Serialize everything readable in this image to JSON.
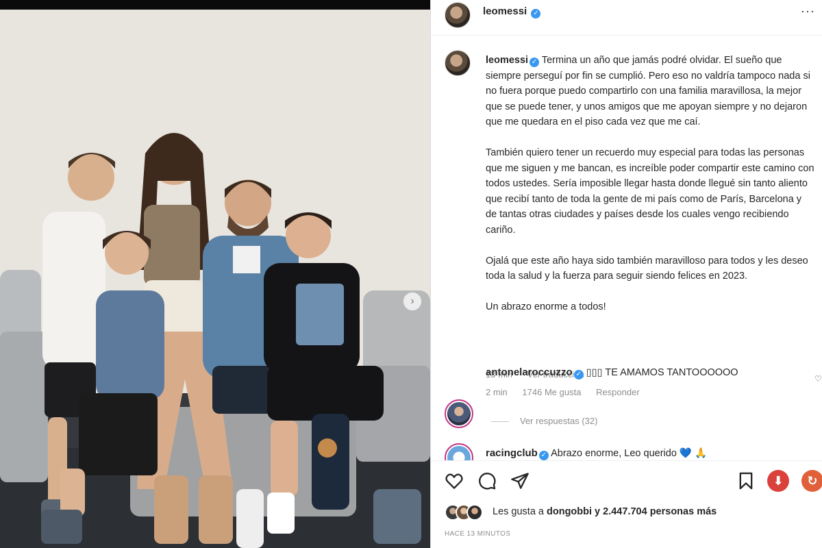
{
  "header": {
    "username": "leomessi",
    "verified_mark": "✓",
    "more_icon": "···"
  },
  "photo": {
    "carousel_next": "›"
  },
  "caption": {
    "username": "leomessi",
    "paragraphs": [
      "Termina un año que jamás podré olvidar. El sueño que siempre perseguí por fin se cumplió. Pero eso no valdría tampoco nada si no fuera porque puedo compartirlo con una familia maravillosa, la mejor que se puede tener, y unos amigos que me apoyan siempre y no dejaron que me quedara en el piso cada vez que me caí.",
      "También quiero tener un recuerdo muy especial para todas las personas que me siguen y me bancan, es increíble poder compartir este camino con todos ustedes. Sería imposible llegar hasta donde llegué sin tanto aliento que recibí tanto de toda la gente de mi país como de París, Barcelona y de tantas otras ciudades y países desde los cuales vengo recibiendo cariño.",
      "Ojalá que este año haya sido también maravilloso para todos y les deseo toda la salud y la fuerza para seguir siendo felices en 2023.",
      "Un abrazo enorme a todos!"
    ],
    "time": "13 min",
    "translate": "Ver traducción"
  },
  "comments": [
    {
      "username": "antonelaroccuzzo",
      "text": "▯▯▯ TE AMAMOS TANTOOOOOO",
      "time": "2 min",
      "likes": "1746 Me gusta",
      "reply": "Responder",
      "view_replies": "Ver respuestas (32)"
    },
    {
      "username": "racingclub",
      "text": "Abrazo enorme, Leo querido 💙 🙏"
    }
  ],
  "likes": {
    "text_prefix": "Les gusta a ",
    "user": "dongobbi",
    "text_suffix": " y 2.447.704 personas más"
  },
  "timestamp": "HACE 13 MINUTOS",
  "colors": {
    "verified": "#3897f0",
    "download_red": "#d9413a",
    "download_orange": "#e0603a"
  },
  "icons": [
    "heart-icon",
    "comment-icon",
    "share-icon",
    "bookmark-icon",
    "download-icon"
  ]
}
